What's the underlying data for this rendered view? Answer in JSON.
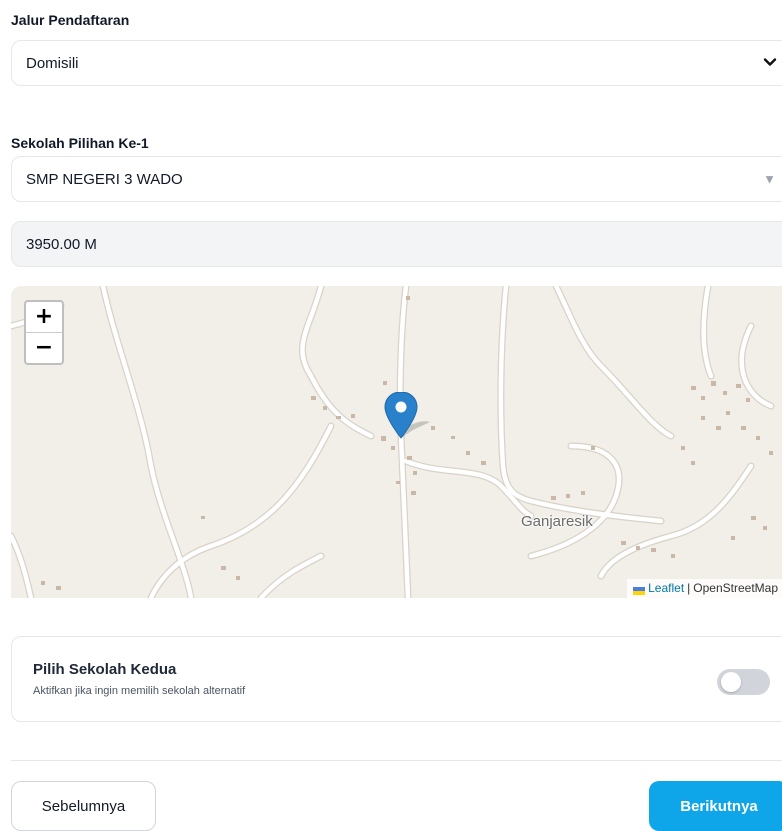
{
  "registration": {
    "label": "Jalur Pendaftaran",
    "value": "Domisili"
  },
  "school_choice_1": {
    "label": "Sekolah Pilihan Ke-1",
    "value": "SMP NEGERI 3 WADO"
  },
  "distance": {
    "value": "3950.00 M"
  },
  "map": {
    "zoom_in": "+",
    "zoom_out": "−",
    "place_label": "Ganjaresik",
    "attribution_link": "Leaflet",
    "attribution_sep": "|",
    "attribution_text": "OpenStreetMap",
    "marker_icon": "map-marker-icon",
    "colors": {
      "land": "#f2efe9",
      "road": "#ffffff",
      "building": "#c9b8a7",
      "marker": "#2a81cb"
    }
  },
  "second_school": {
    "title": "Pilih Sekolah Kedua",
    "subtitle": "Aktifkan jika ingin memilih sekolah alternatif",
    "enabled": false
  },
  "nav": {
    "prev_label": "Sebelumnya",
    "next_label": "Berikutnya"
  },
  "colors": {
    "primary": "#0ea5e9",
    "toggle_off": "#d1d5db"
  }
}
